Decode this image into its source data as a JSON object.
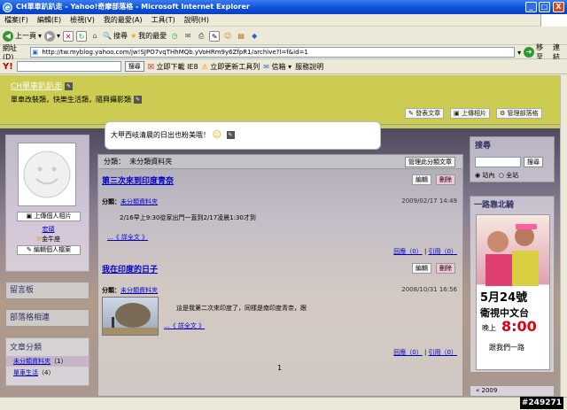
{
  "window": {
    "title": "CH單車趴趴走 - Yahoo!奇摩部落格 - Microsoft Internet Explorer",
    "controls": [
      "_",
      "□",
      "X"
    ]
  },
  "menu": [
    "檔案(F)",
    "編輯(E)",
    "檢視(V)",
    "我的最愛(A)",
    "工具(T)",
    "說明(H)"
  ],
  "toolbar": {
    "back": "上一頁",
    "search": "搜尋",
    "favorites": "我的最愛"
  },
  "address": {
    "label": "網址(D)",
    "url": "http://tw.myblog.yahoo.com/jw!SJPO7vqTHhMQb.yVoHRm9y6ZfpR1/archive?l=f&id=1",
    "go": "移至",
    "links": "連結"
  },
  "yahoo_toolbar": {
    "logo": "Y!",
    "search_button": "搜尋",
    "download": "立即下載 IE8",
    "update": "立即更新工具列",
    "mail": "信箱",
    "help": "服務說明"
  },
  "header": {
    "blog_title": "CH單車趴趴走",
    "blog_desc": "單車改裝類，快樂生活類，隨興攝影類",
    "btn_post": "發表文章",
    "btn_upload": "上傳相片",
    "btn_manage": "管理部落格"
  },
  "bubble": {
    "text": "大甲西岐清晨的日出也粉美哦！"
  },
  "profile": {
    "upload_photo": "上傳個人相片",
    "nickname": "宏碩",
    "zodiac": "金牛座",
    "edit_profile": "編輯個人檔案"
  },
  "left_sections": {
    "guestbook": "留言板",
    "blog_links": "部落格相連",
    "categories_title": "文章分類",
    "categories": [
      {
        "name": "未分類資料夾",
        "count": "（1）"
      },
      {
        "name": "單車生活",
        "count": "（4）"
      }
    ]
  },
  "main": {
    "category_label": "分類：",
    "category_name": "未分類資料夾",
    "manage_category": "管理此分類文章",
    "edit": "編輯",
    "delete": "刪除",
    "posts": [
      {
        "title": "第三次來到印度青奈",
        "cat_label": "分類：",
        "cat": "未分類資料夾",
        "date": "2009/02/17 14:49",
        "body": "2/16早上9:30從家出門一直到2/17凌晨1:30才到",
        "more": "...《 詳全文 》",
        "reply": "回應（0）",
        "trackback": "引用（0）"
      },
      {
        "title": "我在印度的日子",
        "cat_label": "分類：",
        "cat": "未分類資料夾",
        "date": "2008/10/31 16:56",
        "body": "這是我第二次來印度了，同樣是南印度青奈，跟",
        "more": "...《 詳全文 》",
        "reply": "回應（0）",
        "trackback": "引用（0）"
      }
    ],
    "page_number": "1"
  },
  "right": {
    "search_title": "搜尋",
    "search_button": "搜尋",
    "radio_site": "站內",
    "radio_all": "全站",
    "ad_title": "一路靠北騎",
    "ad_date": "5月24號",
    "ad_channel": "衛視中文台",
    "ad_time_label": "晚上",
    "ad_time": "8:00",
    "ad_slogan": "跟我們一路",
    "calendar": "2009"
  },
  "watermark": "#249271"
}
